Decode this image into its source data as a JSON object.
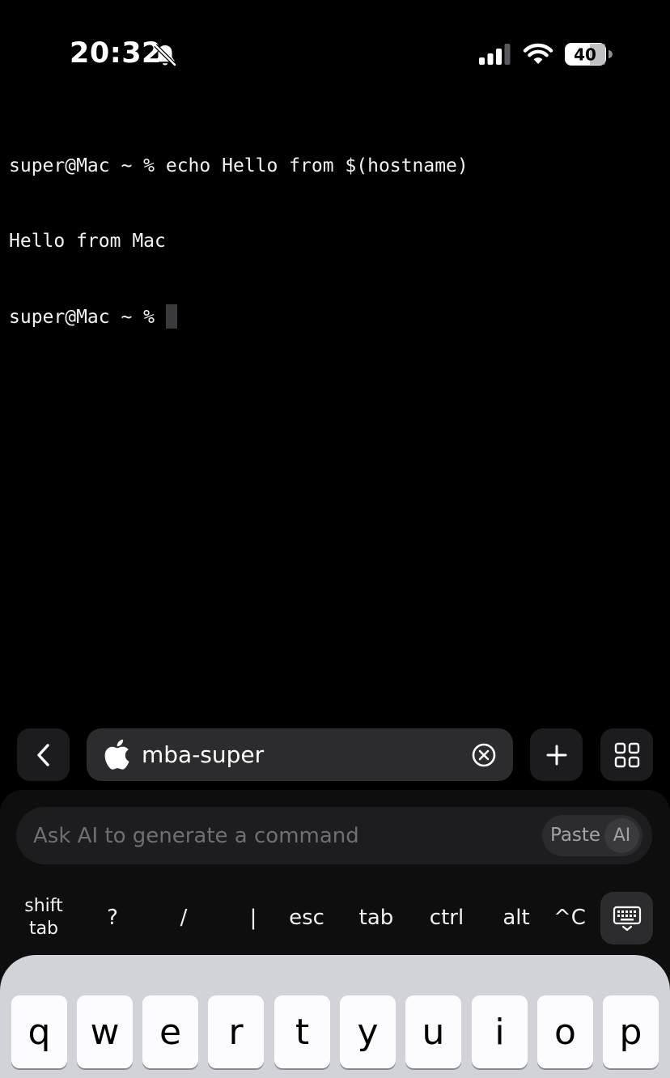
{
  "status_bar": {
    "time": "20:32",
    "battery_level": "40",
    "icons": [
      "bell-slash-icon",
      "cellular-signal-icon",
      "wifi-icon",
      "battery-icon"
    ]
  },
  "terminal": {
    "lines": [
      "super@Mac ~ % echo Hello from $(hostname)",
      "Hello from Mac",
      "super@Mac ~ % "
    ]
  },
  "host_bar": {
    "host_name": "mba-super",
    "icons": [
      "chevron-left-icon",
      "apple-logo-icon",
      "clear-icon",
      "plus-icon",
      "grid-icon"
    ]
  },
  "ai_bar": {
    "placeholder": "Ask AI to generate a command",
    "paste_label": "Paste",
    "ai_label": "AI"
  },
  "extra_keys": {
    "shift_tab_line1": "shift",
    "shift_tab_line2": "tab",
    "question": "?",
    "slash": "/",
    "pipe": "|",
    "esc": "esc",
    "tab": "tab",
    "ctrl": "ctrl",
    "alt": "alt",
    "ctrl_c": "^C",
    "keyboard_toggle_icon": "keyboard-dismiss-icon"
  },
  "keyboard": {
    "row1": [
      "q",
      "w",
      "e",
      "r",
      "t",
      "y",
      "u",
      "i",
      "o",
      "p"
    ]
  }
}
